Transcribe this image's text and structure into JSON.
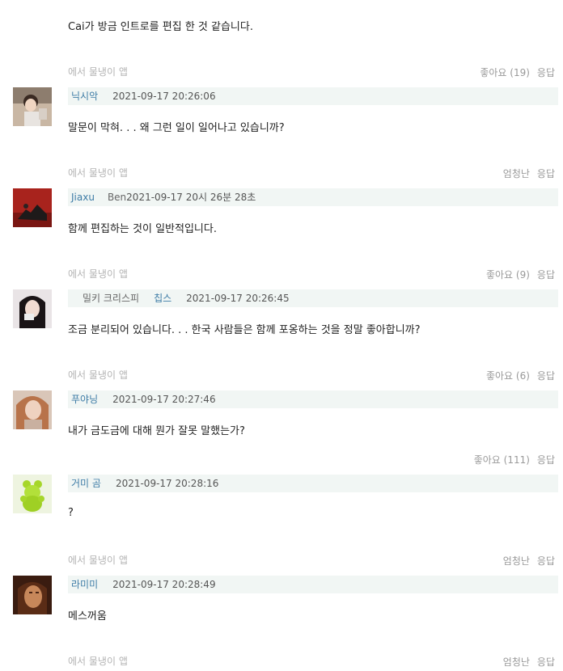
{
  "intro": {
    "text": "Cai가 방금 인트로를 편집 한 것 같습니다."
  },
  "comments": [
    {
      "source": "에서 물냉이 앱",
      "actions": {
        "like": "좋아요 (19)",
        "reply": "응답"
      },
      "user": "닉시악",
      "time": "2021-09-17 20:26:06",
      "body": "말문이 막혀. . . 왜 그런 일이 일어나고 있습니까?"
    },
    {
      "source": "에서 물냉이 앱",
      "actions": {
        "like": "엄청난",
        "reply": "응답"
      },
      "user": "Jiaxu",
      "user_extra": "Ben",
      "time": "2021-09-17 20시 26분 28초",
      "body": "함께 편집하는 것이 일반적입니다."
    },
    {
      "source": "에서 물냉이 앱",
      "actions": {
        "like": "좋아요 (9)",
        "reply": "응답"
      },
      "user": "밀키 크리스피",
      "user_extra": "칩스",
      "time": "2021-09-17 20:26:45",
      "body": "조금 분리되어 있습니다. . . 한국 사람들은 함께 포옹하는 것을 정말 좋아합니까?"
    },
    {
      "source": "에서 물냉이 앱",
      "actions": {
        "like": "좋아요 (6)",
        "reply": "응답"
      },
      "user": "푸야닝",
      "time": "2021-09-17 20:27:46",
      "body": "내가 금도금에 대해 뭔가 잘못 말했는가?"
    },
    {
      "source": "",
      "actions": {
        "like": "좋아요 (111)",
        "reply": "응답"
      },
      "user": "거미 곰",
      "time": "2021-09-17 20:28:16",
      "body": "?"
    },
    {
      "source": "에서 물냉이 앱",
      "actions": {
        "like": "엄청난",
        "reply": "응답"
      },
      "user": "라미미",
      "time": "2021-09-17 20:28:49",
      "body": "메스꺼움"
    }
  ],
  "footer": {
    "source": "에서 물냉이 앱",
    "actions": {
      "like": "엄청난",
      "reply": "응답"
    }
  }
}
